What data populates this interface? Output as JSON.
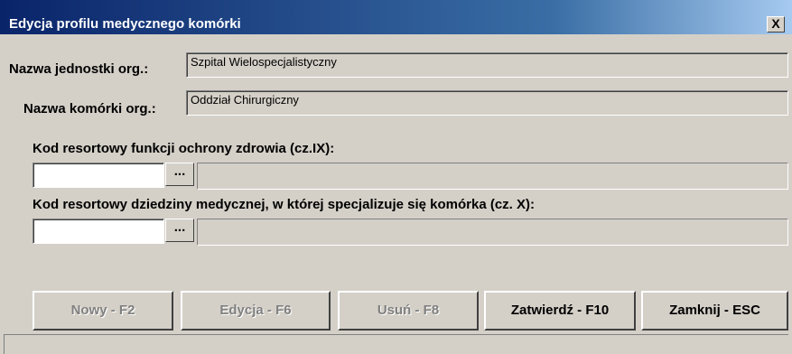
{
  "window": {
    "title": "Edycja profilu medycznego komórki",
    "close_glyph": "X"
  },
  "unit": {
    "label": "Nazwa jednostki org.:",
    "value": "Szpital Wielospecjalistyczny"
  },
  "cell": {
    "label": "Nazwa komórki org.:",
    "value": "Oddział Chirurgiczny"
  },
  "health_function": {
    "label": "Kod resortowy funkcji ochrony zdrowia (cz.IX):",
    "code": "",
    "lookup_label": "...",
    "description": ""
  },
  "medical_domain": {
    "label": "Kod resortowy dziedziny medycznej, w której specjalizuje się komórka (cz. X):",
    "code": "",
    "lookup_label": "...",
    "description": ""
  },
  "buttons": {
    "new": "Nowy - F2",
    "edit": "Edycja - F6",
    "delete": "Usuń - F8",
    "confirm": "Zatwierdź - F10",
    "close": "Zamknij - ESC"
  },
  "status": {
    "text": ""
  }
}
